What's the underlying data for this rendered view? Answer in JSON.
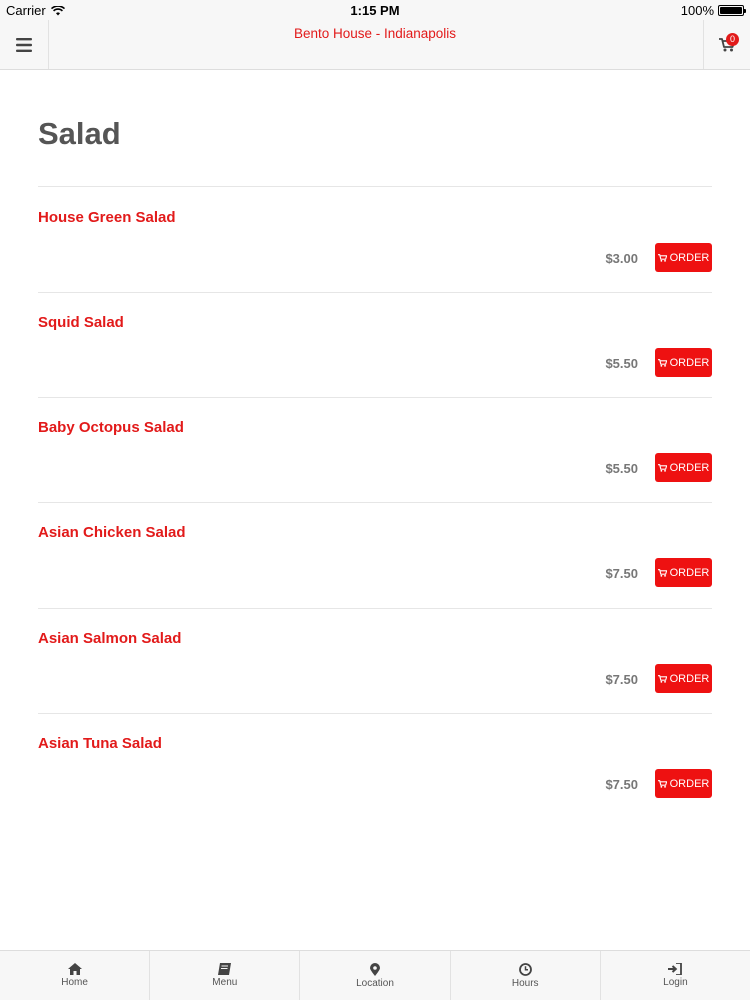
{
  "status_bar": {
    "carrier": "Carrier",
    "time": "1:15 PM",
    "battery": "100%"
  },
  "nav": {
    "title": "Bento House - Indianapolis",
    "cart_count": "0"
  },
  "page": {
    "title": "Salad"
  },
  "items": [
    {
      "name": "House Green Salad",
      "price": "$3.00",
      "order_label": "ORDER"
    },
    {
      "name": "Squid Salad",
      "price": "$5.50",
      "order_label": "ORDER"
    },
    {
      "name": "Baby Octopus Salad",
      "price": "$5.50",
      "order_label": "ORDER"
    },
    {
      "name": "Asian Chicken Salad",
      "price": "$7.50",
      "order_label": "ORDER"
    },
    {
      "name": "Asian Salmon Salad",
      "price": "$7.50",
      "order_label": "ORDER"
    },
    {
      "name": "Asian Tuna Salad",
      "price": "$7.50",
      "order_label": "ORDER"
    }
  ],
  "tabs": [
    {
      "label": "Home",
      "icon": "home-icon"
    },
    {
      "label": "Menu",
      "icon": "book-icon"
    },
    {
      "label": "Location",
      "icon": "map-pin-icon"
    },
    {
      "label": "Hours",
      "icon": "clock-icon"
    },
    {
      "label": "Login",
      "icon": "sign-in-icon"
    }
  ],
  "colors": {
    "accent": "#e21a1a",
    "button": "#ee1111",
    "price": "#777777",
    "title": "#555555"
  }
}
